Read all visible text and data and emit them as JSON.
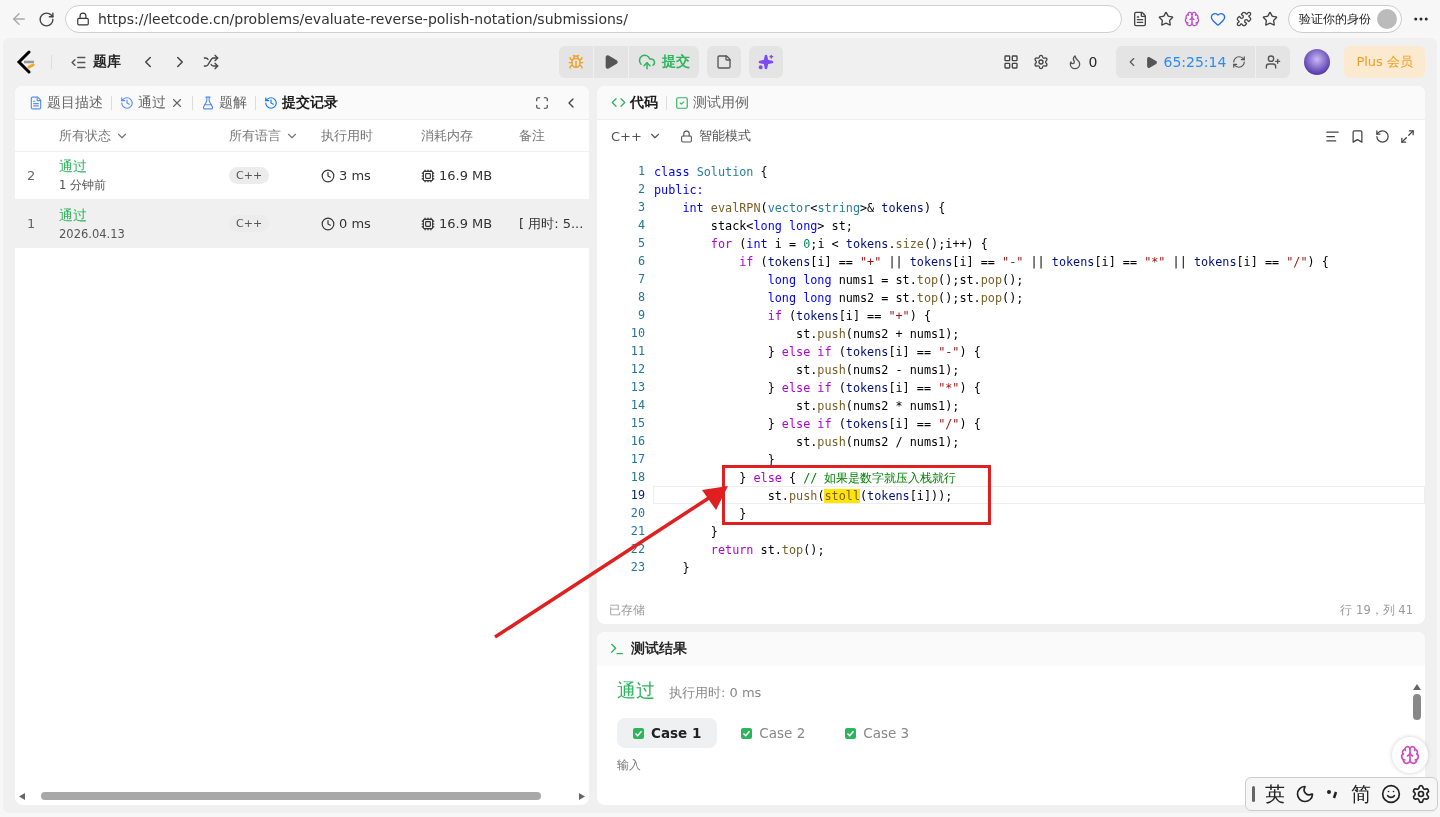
{
  "browser": {
    "url": "https://leetcode.cn/problems/evaluate-reverse-polish-notation/submissions/",
    "profile_button": "验证你的身份"
  },
  "header": {
    "problem_bank": "题库",
    "submit": "提交",
    "streak": "0",
    "timer": "65:25:14",
    "plus": "Plus 会员"
  },
  "left_panel": {
    "tabs": [
      {
        "label": "题目描述",
        "kind": "description",
        "selected": false,
        "closable": false
      },
      {
        "label": "通过",
        "kind": "history",
        "selected": false,
        "closable": true
      },
      {
        "label": "题解",
        "kind": "solution",
        "selected": false,
        "closable": false
      },
      {
        "label": "提交记录",
        "kind": "history",
        "selected": true,
        "closable": false
      }
    ],
    "columns": [
      {
        "label": "所有状态",
        "dropdown": true
      },
      {
        "label": "所有语言",
        "dropdown": true
      },
      {
        "label": "执行用时",
        "dropdown": false
      },
      {
        "label": "消耗内存",
        "dropdown": false
      },
      {
        "label": "备注",
        "dropdown": false
      }
    ],
    "rows": [
      {
        "index": "2",
        "status": "通过",
        "when": "1 分钟前",
        "language": "C++",
        "runtime": "3 ms",
        "memory": "16.9 MB",
        "selected": false
      },
      {
        "index": "1",
        "status": "通过",
        "when": "2026.04.13",
        "language": "C++",
        "runtime": "0 ms",
        "memory": "16.9 MB",
        "note": "[ 用时: 5...",
        "selected": true
      }
    ]
  },
  "editor": {
    "tabs": [
      {
        "label": "代码",
        "kind": "code",
        "selected": true
      },
      {
        "label": "测试用例",
        "kind": "testcase",
        "selected": false
      }
    ],
    "language": "C++",
    "mode": "智能模式",
    "saved": "已存储",
    "cursor": "行 19，列 41",
    "lines": [
      {
        "n": "1",
        "current": false,
        "tokens": [
          {
            "kind": "kw",
            "text": "class "
          },
          {
            "kind": "type",
            "text": "Solution"
          },
          {
            "kind": "plain",
            "text": " {"
          }
        ]
      },
      {
        "n": "2",
        "current": false,
        "tokens": [
          {
            "kind": "kw",
            "text": "public:"
          }
        ]
      },
      {
        "n": "3",
        "current": false,
        "tokens": [
          {
            "kind": "kw",
            "text": "    int "
          },
          {
            "kind": "fn",
            "text": "evalRPN"
          },
          {
            "kind": "plain",
            "text": "("
          },
          {
            "kind": "type",
            "text": "vector"
          },
          {
            "kind": "plain",
            "text": "<"
          },
          {
            "kind": "type",
            "text": "string"
          },
          {
            "kind": "plain",
            "text": ">& "
          },
          {
            "kind": "var",
            "text": "tokens"
          },
          {
            "kind": "plain",
            "text": ") {"
          }
        ]
      },
      {
        "n": "4",
        "current": false,
        "tokens": [
          {
            "kind": "plain",
            "text": "        stack<"
          },
          {
            "kind": "kw",
            "text": "long long"
          },
          {
            "kind": "plain",
            "text": "> st;"
          }
        ]
      },
      {
        "n": "5",
        "current": false,
        "tokens": [
          {
            "kind": "ctl",
            "text": "        for"
          },
          {
            "kind": "plain",
            "text": " ("
          },
          {
            "kind": "kw",
            "text": "int"
          },
          {
            "kind": "plain",
            "text": " i = "
          },
          {
            "kind": "num",
            "text": "0"
          },
          {
            "kind": "plain",
            "text": ";i < "
          },
          {
            "kind": "var",
            "text": "tokens"
          },
          {
            "kind": "plain",
            "text": "."
          },
          {
            "kind": "fn",
            "text": "size"
          },
          {
            "kind": "plain",
            "text": "();i++) {"
          }
        ]
      },
      {
        "n": "6",
        "current": false,
        "tokens": [
          {
            "kind": "ctl",
            "text": "            if"
          },
          {
            "kind": "plain",
            "text": " ("
          },
          {
            "kind": "var",
            "text": "tokens"
          },
          {
            "kind": "plain",
            "text": "[i] == "
          },
          {
            "kind": "str",
            "text": "\"+\""
          },
          {
            "kind": "plain",
            "text": " || "
          },
          {
            "kind": "var",
            "text": "tokens"
          },
          {
            "kind": "plain",
            "text": "[i] == "
          },
          {
            "kind": "str",
            "text": "\"-\""
          },
          {
            "kind": "plain",
            "text": " || "
          },
          {
            "kind": "var",
            "text": "tokens"
          },
          {
            "kind": "plain",
            "text": "[i] == "
          },
          {
            "kind": "str",
            "text": "\"*\""
          },
          {
            "kind": "plain",
            "text": " || "
          },
          {
            "kind": "var",
            "text": "tokens"
          },
          {
            "kind": "plain",
            "text": "[i] == "
          },
          {
            "kind": "str",
            "text": "\"/\""
          },
          {
            "kind": "plain",
            "text": ") {"
          }
        ]
      },
      {
        "n": "7",
        "current": false,
        "tokens": [
          {
            "kind": "kw",
            "text": "                long long"
          },
          {
            "kind": "plain",
            "text": " nums1 = st."
          },
          {
            "kind": "fn",
            "text": "top"
          },
          {
            "kind": "plain",
            "text": "();st."
          },
          {
            "kind": "fn",
            "text": "pop"
          },
          {
            "kind": "plain",
            "text": "();"
          }
        ]
      },
      {
        "n": "8",
        "current": false,
        "tokens": [
          {
            "kind": "kw",
            "text": "                long long"
          },
          {
            "kind": "plain",
            "text": " nums2 = st."
          },
          {
            "kind": "fn",
            "text": "top"
          },
          {
            "kind": "plain",
            "text": "();st."
          },
          {
            "kind": "fn",
            "text": "pop"
          },
          {
            "kind": "plain",
            "text": "();"
          }
        ]
      },
      {
        "n": "9",
        "current": false,
        "tokens": [
          {
            "kind": "ctl",
            "text": "                if"
          },
          {
            "kind": "plain",
            "text": " ("
          },
          {
            "kind": "var",
            "text": "tokens"
          },
          {
            "kind": "plain",
            "text": "[i] == "
          },
          {
            "kind": "str",
            "text": "\"+\""
          },
          {
            "kind": "plain",
            "text": ") {"
          }
        ]
      },
      {
        "n": "10",
        "current": false,
        "tokens": [
          {
            "kind": "plain",
            "text": "                    st."
          },
          {
            "kind": "fn",
            "text": "push"
          },
          {
            "kind": "plain",
            "text": "(nums2 + nums1);"
          }
        ]
      },
      {
        "n": "11",
        "current": false,
        "tokens": [
          {
            "kind": "plain",
            "text": "                } "
          },
          {
            "kind": "ctl",
            "text": "else if"
          },
          {
            "kind": "plain",
            "text": " ("
          },
          {
            "kind": "var",
            "text": "tokens"
          },
          {
            "kind": "plain",
            "text": "[i] == "
          },
          {
            "kind": "str",
            "text": "\"-\""
          },
          {
            "kind": "plain",
            "text": ") {"
          }
        ]
      },
      {
        "n": "12",
        "current": false,
        "tokens": [
          {
            "kind": "plain",
            "text": "                    st."
          },
          {
            "kind": "fn",
            "text": "push"
          },
          {
            "kind": "plain",
            "text": "(nums2 - nums1);"
          }
        ]
      },
      {
        "n": "13",
        "current": false,
        "tokens": [
          {
            "kind": "plain",
            "text": "                } "
          },
          {
            "kind": "ctl",
            "text": "else if"
          },
          {
            "kind": "plain",
            "text": " ("
          },
          {
            "kind": "var",
            "text": "tokens"
          },
          {
            "kind": "plain",
            "text": "[i] == "
          },
          {
            "kind": "str",
            "text": "\"*\""
          },
          {
            "kind": "plain",
            "text": ") {"
          }
        ]
      },
      {
        "n": "14",
        "current": false,
        "tokens": [
          {
            "kind": "plain",
            "text": "                    st."
          },
          {
            "kind": "fn",
            "text": "push"
          },
          {
            "kind": "plain",
            "text": "(nums2 * nums1);"
          }
        ]
      },
      {
        "n": "15",
        "current": false,
        "tokens": [
          {
            "kind": "plain",
            "text": "                } "
          },
          {
            "kind": "ctl",
            "text": "else if"
          },
          {
            "kind": "plain",
            "text": " ("
          },
          {
            "kind": "var",
            "text": "tokens"
          },
          {
            "kind": "plain",
            "text": "[i] == "
          },
          {
            "kind": "str",
            "text": "\"/\""
          },
          {
            "kind": "plain",
            "text": ") {"
          }
        ]
      },
      {
        "n": "16",
        "current": false,
        "tokens": [
          {
            "kind": "plain",
            "text": "                    st."
          },
          {
            "kind": "fn",
            "text": "push"
          },
          {
            "kind": "plain",
            "text": "(nums2 / nums1);"
          }
        ]
      },
      {
        "n": "17",
        "current": false,
        "tokens": [
          {
            "kind": "plain",
            "text": "                }"
          }
        ]
      },
      {
        "n": "18",
        "current": false,
        "tokens": [
          {
            "kind": "plain",
            "text": "            } "
          },
          {
            "kind": "ctl",
            "text": "else"
          },
          {
            "kind": "plain",
            "text": " { "
          },
          {
            "kind": "cm",
            "text": "// 如果是数字就压入栈就行"
          }
        ]
      },
      {
        "n": "19",
        "current": true,
        "tokens": [
          {
            "kind": "plain",
            "text": "                st."
          },
          {
            "kind": "fn",
            "text": "push"
          },
          {
            "kind": "plain",
            "text": "("
          },
          {
            "kind": "hl",
            "text": "stoll"
          },
          {
            "kind": "plain",
            "text": "("
          },
          {
            "kind": "var",
            "text": "tokens"
          },
          {
            "kind": "plain",
            "text": "[i]));"
          }
        ]
      },
      {
        "n": "20",
        "current": false,
        "tokens": [
          {
            "kind": "plain",
            "text": "            }"
          }
        ]
      },
      {
        "n": "21",
        "current": false,
        "tokens": [
          {
            "kind": "plain",
            "text": "        }"
          }
        ]
      },
      {
        "n": "22",
        "current": false,
        "tokens": [
          {
            "kind": "ctl",
            "text": "        return"
          },
          {
            "kind": "plain",
            "text": " st."
          },
          {
            "kind": "fn",
            "text": "top"
          },
          {
            "kind": "plain",
            "text": "();"
          }
        ]
      },
      {
        "n": "23",
        "current": false,
        "tokens": [
          {
            "kind": "plain",
            "text": "    }"
          }
        ]
      }
    ]
  },
  "results": {
    "title": "测试结果",
    "verdict": "通过",
    "runtime": "执行用时: 0 ms",
    "cases": [
      {
        "label": "Case 1",
        "selected": true
      },
      {
        "label": "Case 2",
        "selected": false
      },
      {
        "label": "Case 3",
        "selected": false
      }
    ],
    "input_label": "输入"
  },
  "ime": {
    "items": [
      "英",
      "简"
    ]
  }
}
